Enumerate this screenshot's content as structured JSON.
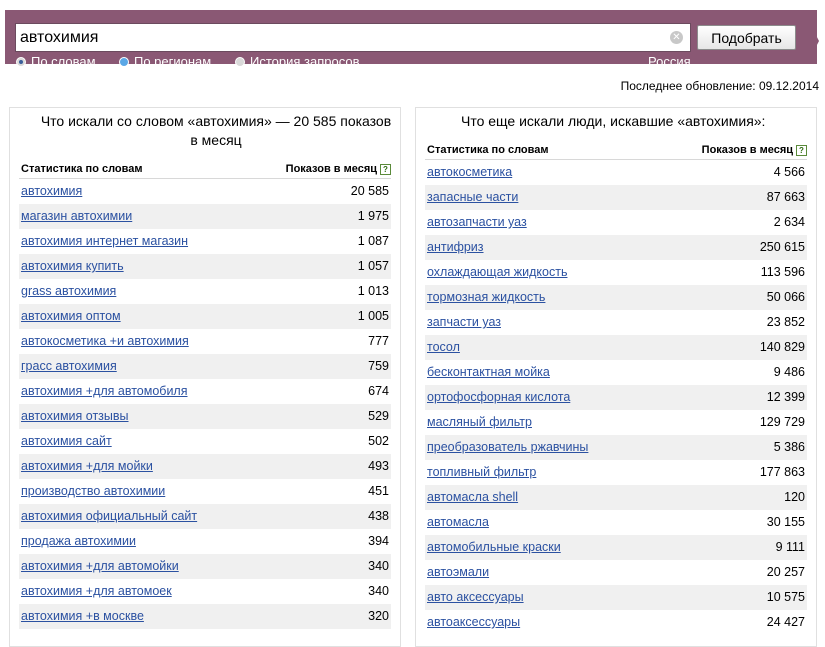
{
  "search": {
    "query": "автохимия",
    "submit_label": "Подобрать"
  },
  "modes": [
    {
      "label": "По словам",
      "checked": true
    },
    {
      "label": "По регионам",
      "checked": false
    },
    {
      "label": "История запросов",
      "checked": false
    }
  ],
  "region": "Россия",
  "last_update": "Последнее обновление: 09.12.2014",
  "left_panel": {
    "title": "Что искали со словом «автохимия» — 20 585 показов в месяц",
    "col_phrase": "Статистика по словам",
    "col_count": "Показов в месяц",
    "rows": [
      {
        "phrase": "автохимия",
        "count": "20 585"
      },
      {
        "phrase": "магазин автохимии",
        "count": "1 975"
      },
      {
        "phrase": "автохимия интернет магазин",
        "count": "1 087"
      },
      {
        "phrase": "автохимия купить",
        "count": "1 057"
      },
      {
        "phrase": "grass автохимия",
        "count": "1 013"
      },
      {
        "phrase": "автохимия оптом",
        "count": "1 005"
      },
      {
        "phrase": "автокосметика +и автохимия",
        "count": "777"
      },
      {
        "phrase": "грасс автохимия",
        "count": "759"
      },
      {
        "phrase": "автохимия +для автомобиля",
        "count": "674"
      },
      {
        "phrase": "автохимия отзывы",
        "count": "529"
      },
      {
        "phrase": "автохимия сайт",
        "count": "502"
      },
      {
        "phrase": "автохимия +для мойки",
        "count": "493"
      },
      {
        "phrase": "производство автохимии",
        "count": "451"
      },
      {
        "phrase": "автохимия официальный сайт",
        "count": "438"
      },
      {
        "phrase": "продажа автохимии",
        "count": "394"
      },
      {
        "phrase": "автохимия +для автомойки",
        "count": "340"
      },
      {
        "phrase": "автохимия +для автомоек",
        "count": "340"
      },
      {
        "phrase": "автохимия +в москве",
        "count": "320"
      }
    ]
  },
  "right_panel": {
    "title": "Что еще искали люди, искавшие «автохимия»:",
    "col_phrase": "Статистика по словам",
    "col_count": "Показов в месяц",
    "rows": [
      {
        "phrase": "автокосметика",
        "count": "4 566"
      },
      {
        "phrase": "запасные части",
        "count": "87 663"
      },
      {
        "phrase": "автозапчасти уаз",
        "count": "2 634"
      },
      {
        "phrase": "антифриз",
        "count": "250 615"
      },
      {
        "phrase": "охлаждающая жидкость",
        "count": "113 596"
      },
      {
        "phrase": "тормозная жидкость",
        "count": "50 066"
      },
      {
        "phrase": "запчасти уаз",
        "count": "23 852"
      },
      {
        "phrase": "тосол",
        "count": "140 829"
      },
      {
        "phrase": "бесконтактная мойка",
        "count": "9 486"
      },
      {
        "phrase": "ортофосфорная кислота",
        "count": "12 399"
      },
      {
        "phrase": "масляный фильтр",
        "count": "129 729"
      },
      {
        "phrase": "преобразователь ржавчины",
        "count": "5 386"
      },
      {
        "phrase": "топливный фильтр",
        "count": "177 863"
      },
      {
        "phrase": "автомасла shell",
        "count": "120"
      },
      {
        "phrase": "автомасла",
        "count": "30 155"
      },
      {
        "phrase": "автомобильные краски",
        "count": "9 111"
      },
      {
        "phrase": "автоэмали",
        "count": "20 257"
      },
      {
        "phrase": "авто аксессуары",
        "count": "10 575"
      },
      {
        "phrase": "автоаксессуары",
        "count": "24 427"
      }
    ]
  },
  "colors": {
    "bar": "#8a5874",
    "link": "#2b51a1",
    "row_shade": "#f0f0f0"
  }
}
